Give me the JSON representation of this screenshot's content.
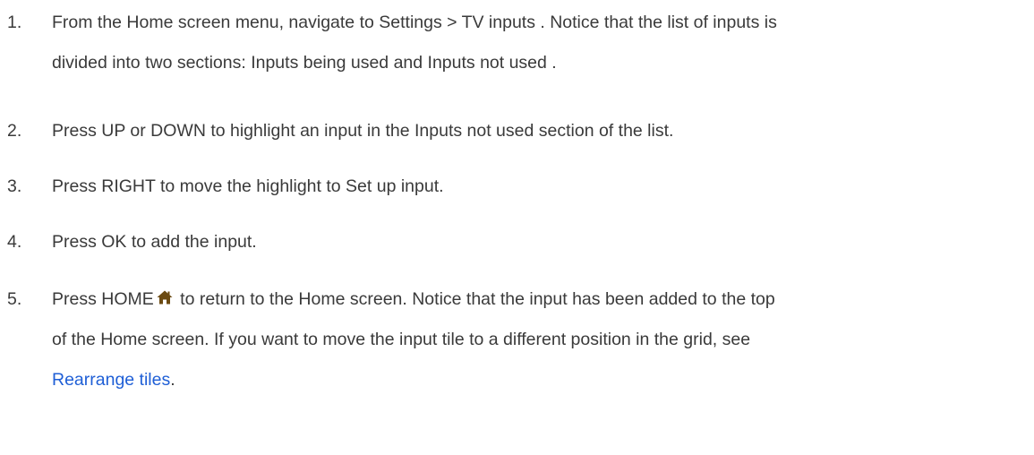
{
  "steps": [
    {
      "number": "1.",
      "lines": [
        "From the Home screen menu, navigate to Settings  > TV inputs . Notice that the list of inputs is",
        "divided into two sections: Inputs being used  and Inputs not used ."
      ]
    },
    {
      "number": "2.",
      "text": "Press UP or DOWN to highlight an input in the Inputs not used  section of the list."
    },
    {
      "number": "3.",
      "text": "Press RIGHT to move the highlight to Set up input."
    },
    {
      "number": "4.",
      "text": "Press OK to add the input."
    },
    {
      "number": "5.",
      "before_icon": "Press HOME",
      "icon": "home-icon",
      "after_icon": " to return to the Home screen. Notice that the input has been added to the top",
      "line2": "of the Home screen. If you want to move the input tile to a different position in the grid, see",
      "link_text": "Rearrange tiles",
      "after_link": "."
    }
  ],
  "colors": {
    "text": "#3a3a3a",
    "link": "#1f5fd6",
    "icon": "#6b4a12"
  }
}
